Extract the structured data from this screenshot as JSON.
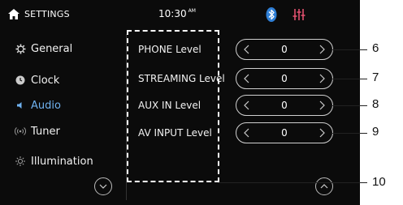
{
  "header": {
    "title": "SETTINGS",
    "time": "10:30",
    "ampm": "AM"
  },
  "sidebar": {
    "items": [
      {
        "label": "General",
        "icon": "gear-icon"
      },
      {
        "label": "Clock",
        "icon": "clock-icon"
      },
      {
        "label": "Audio",
        "icon": "speaker-icon",
        "active": true
      },
      {
        "label": "Tuner",
        "icon": "radio-waves-icon"
      },
      {
        "label": "Illumination",
        "icon": "sun-icon"
      }
    ]
  },
  "levels": [
    {
      "label": "PHONE Level",
      "value": "0",
      "callout": "6"
    },
    {
      "label": "STREAMING Level",
      "value": "0",
      "callout": "7"
    },
    {
      "label": "AUX IN Level",
      "value": "0",
      "callout": "8"
    },
    {
      "label": "AV INPUT Level",
      "value": "0",
      "callout": "9"
    }
  ],
  "box_callout": "10",
  "colors": {
    "background": "#0b0b0b",
    "active": "#6fb2f0",
    "bluetooth": "#2f7fd6",
    "equalizer": "#e0506e"
  }
}
